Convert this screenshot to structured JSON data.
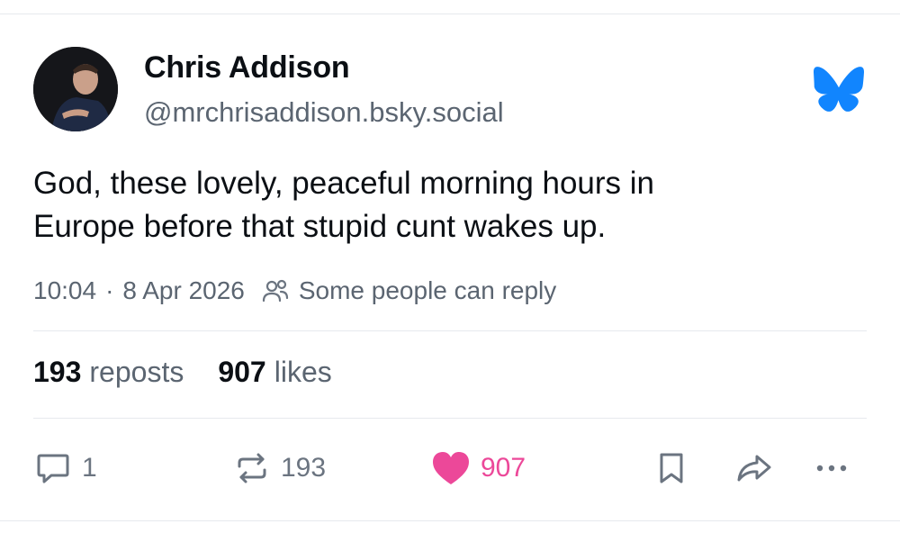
{
  "author": {
    "display_name": "Chris Addison",
    "handle": "@mrchrisaddison.bsky.social"
  },
  "post": {
    "text_lines": [
      "God, these lovely, peaceful morning hours in",
      "Europe before that stupid cunt wakes up."
    ],
    "time": "10:04",
    "separator": "·",
    "date": "8 Apr 2026",
    "reply_permission": "Some people can reply"
  },
  "stats": {
    "reposts_count": "193",
    "reposts_label": "reposts",
    "likes_count": "907",
    "likes_label": "likes"
  },
  "actions": {
    "reply_count": "1",
    "repost_count": "193",
    "like_count": "907"
  },
  "colors": {
    "brand_blue": "#1185fe",
    "like_pink": "#ec4899",
    "muted_text": "#5b6571"
  },
  "icons": [
    "bluesky-butterfly-icon",
    "people-icon",
    "reply-icon",
    "repost-icon",
    "heart-icon",
    "bookmark-icon",
    "share-icon",
    "more-icon"
  ]
}
